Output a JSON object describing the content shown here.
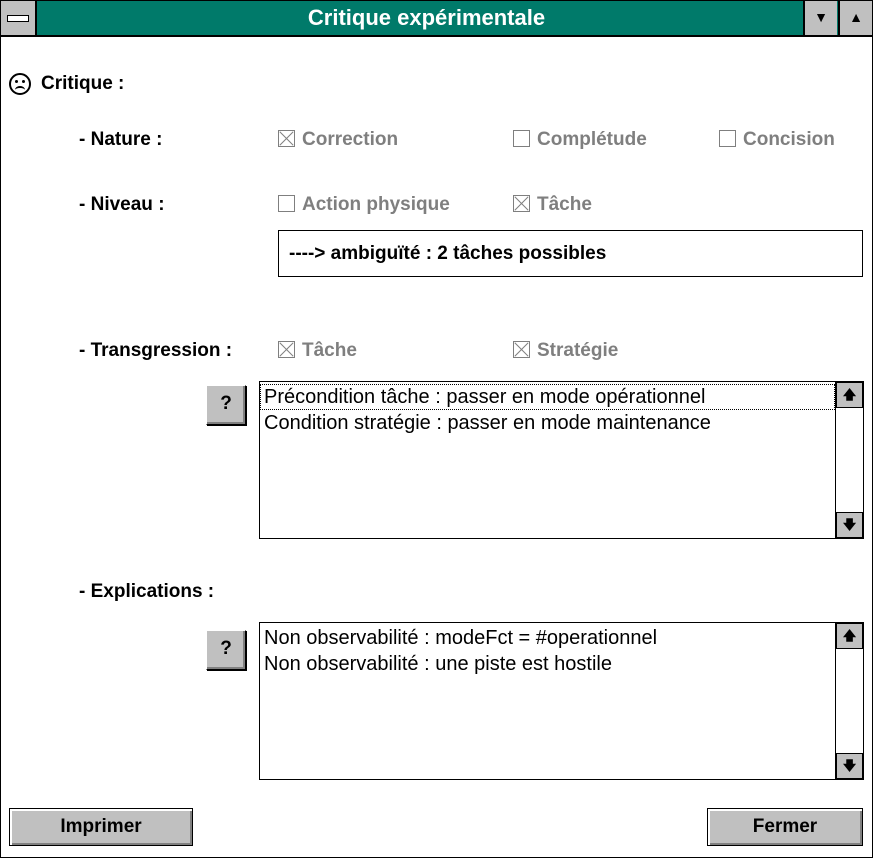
{
  "window": {
    "title": "Critique expérimentale"
  },
  "critique": {
    "label": "Critique :"
  },
  "nature": {
    "label": "- Nature :",
    "options": [
      {
        "label": "Correction",
        "checked": true
      },
      {
        "label": "Complétude",
        "checked": false
      },
      {
        "label": "Concision",
        "checked": false
      }
    ]
  },
  "niveau": {
    "label": "- Niveau :",
    "options": [
      {
        "label": "Action physique",
        "checked": false
      },
      {
        "label": "Tâche",
        "checked": true
      }
    ],
    "result": "----> ambiguïté : 2 tâches possibles"
  },
  "transgression": {
    "label": "- Transgression :",
    "options": [
      {
        "label": "Tâche",
        "checked": true
      },
      {
        "label": "Stratégie",
        "checked": true
      }
    ],
    "help_label": "?",
    "items": [
      "Précondition tâche : passer en mode opérationnel",
      "Condition stratégie : passer en mode maintenance"
    ]
  },
  "explications": {
    "label": "- Explications :",
    "help_label": "?",
    "items": [
      "Non observabilité : modeFct = #operationnel",
      "Non observabilité : une piste est hostile"
    ]
  },
  "buttons": {
    "print": "Imprimer",
    "close": "Fermer"
  },
  "colors": {
    "titlebar": "#007a6a",
    "disabled_text": "#7f7f7f",
    "button_face": "#c0c0c0"
  }
}
